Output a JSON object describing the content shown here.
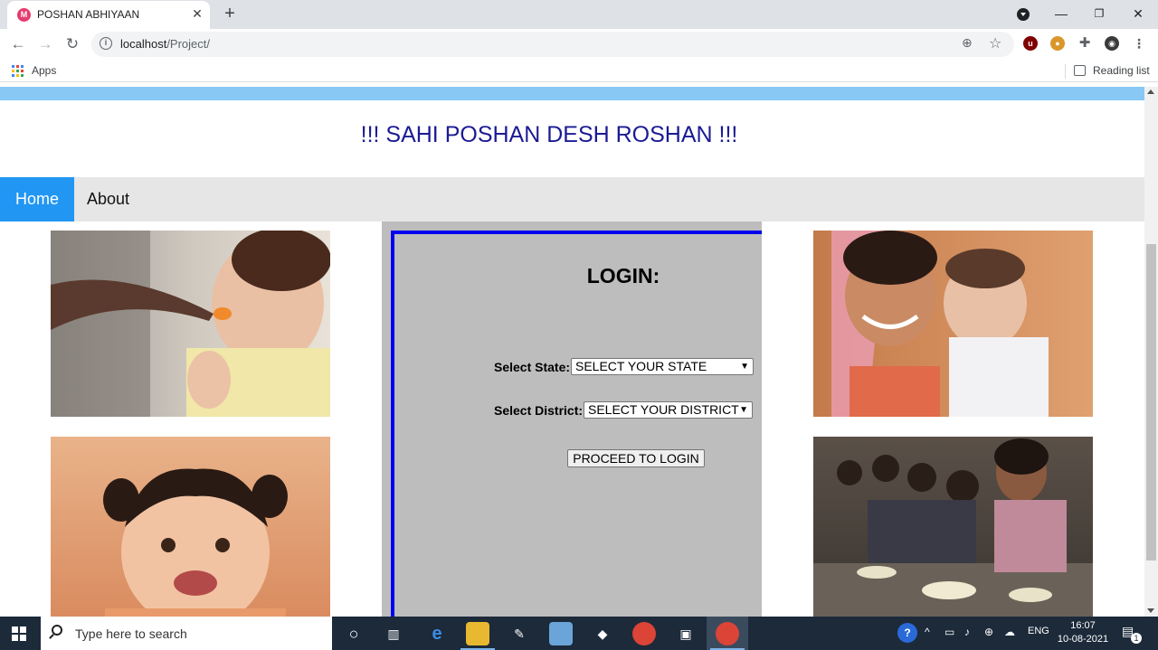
{
  "browser": {
    "tab_title": "POSHAN ABHIYAAN",
    "tab_favicon_letter": "M",
    "url_host": "localhost",
    "url_path": "/Project/",
    "bookmarks": {
      "apps_label": "Apps",
      "reading_list_label": "Reading list"
    }
  },
  "page": {
    "header_title": "!!! SAHI POSHAN DESH ROSHAN !!!",
    "nav": [
      {
        "label": "Home",
        "active": true
      },
      {
        "label": "About",
        "active": false
      }
    ],
    "login": {
      "title": "LOGIN:",
      "state_label": "Select State:",
      "state_selected": "SELECT YOUR STATE",
      "district_label": "Select District:",
      "district_selected": "SELECT YOUR DISTRICT",
      "submit_label": "PROCEED TO LOGIN"
    },
    "colors": {
      "top_band": "#87c8f5",
      "header_text": "#1b1b94",
      "nav_active": "#2196f3",
      "login_panel": "#bdbdbd",
      "login_border": "#0000ee"
    }
  },
  "taskbar": {
    "search_placeholder": "Type here to search",
    "language": "ENG",
    "time": "16:07",
    "date": "10-08-2021",
    "notification_count": "1"
  }
}
